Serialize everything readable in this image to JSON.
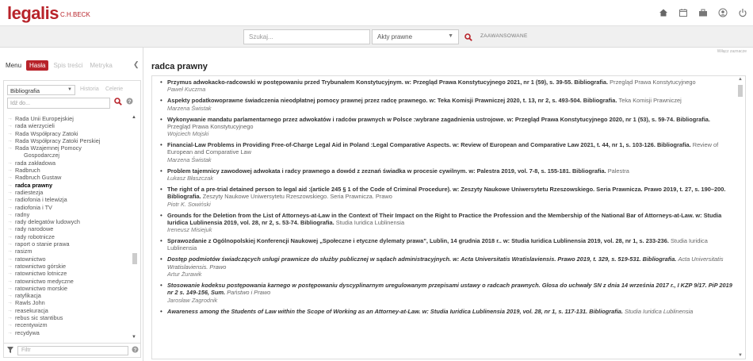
{
  "header": {
    "logo": "legalis",
    "logo_sub": "C.H.BECK",
    "icons": [
      "home-icon",
      "calendar-icon",
      "briefcase-icon",
      "user-icon",
      "power-icon"
    ]
  },
  "search": {
    "placeholder": "Szukaj...",
    "type_select": "Akty prawne",
    "advanced_label": "ZAAWANSOWANE"
  },
  "right_hint": "Wiłącz zaznacze",
  "left": {
    "tabs": [
      {
        "label": "Menu",
        "state": "plain"
      },
      {
        "label": "Hasła",
        "state": "active"
      },
      {
        "label": "Spis treści",
        "state": "disabled"
      },
      {
        "label": "Metryka",
        "state": "disabled"
      }
    ],
    "dropdown_value": "Bibliografia",
    "sub_tabs": [
      "Historia",
      "Celerie"
    ],
    "search_placeholder": "Idź do...",
    "tree": [
      {
        "label": "Rada Unii Europejskiej",
        "arrow": true
      },
      {
        "label": "rada wierzycieli",
        "arrow": true
      },
      {
        "label": "Rada Współpracy Zatoki",
        "arrow": true
      },
      {
        "label": "Rada Współpracy Zatoki Perskiej",
        "arrow": true
      },
      {
        "label": "Rada Wzajemnej Pomocy",
        "arrow": true
      },
      {
        "label": "Gospodarczej",
        "arrow": false
      },
      {
        "label": "rada zakładowa",
        "arrow": true
      },
      {
        "label": "Radbruch",
        "arrow": true
      },
      {
        "label": "Radbruch Gustaw",
        "arrow": true
      },
      {
        "label": "radca prawny",
        "arrow": true,
        "selected": true
      },
      {
        "label": "radiestezja",
        "arrow": true
      },
      {
        "label": "radiofonia i telewizja",
        "arrow": true
      },
      {
        "label": "radiofonia i TV",
        "arrow": true
      },
      {
        "label": "radny",
        "arrow": true
      },
      {
        "label": "rady delegatów ludowych",
        "arrow": true
      },
      {
        "label": "rady narodowe",
        "arrow": true
      },
      {
        "label": "rady robotnicze",
        "arrow": true
      },
      {
        "label": "raport o stanie prawa",
        "arrow": true
      },
      {
        "label": "rasizm",
        "arrow": true
      },
      {
        "label": "ratownictwo",
        "arrow": true
      },
      {
        "label": "ratownictwo górskie",
        "arrow": true
      },
      {
        "label": "ratownictwo lotnicze",
        "arrow": true
      },
      {
        "label": "ratownictwo medyczne",
        "arrow": true
      },
      {
        "label": "ratownictwo morskie",
        "arrow": true
      },
      {
        "label": "ratyfikacja",
        "arrow": true
      },
      {
        "label": "Rawls John",
        "arrow": true
      },
      {
        "label": "reasekuracja",
        "arrow": true
      },
      {
        "label": "rebus sic stantibus",
        "arrow": true
      },
      {
        "label": "recentywizm",
        "arrow": true
      },
      {
        "label": "recydywa",
        "arrow": true
      }
    ],
    "filter_placeholder": "Filtr"
  },
  "main": {
    "title": "radca prawny",
    "results": [
      {
        "title": "Przymus adwokacko-radcowski w postępowaniu przed Trybunałem Konstytucyjnym. w: Przegląd Prawa Konstytucyjnego 2021, nr 1 (59), s. 39-55. Bibliografia.",
        "type": "Przegląd Prawa Konstytucyjnego",
        "author": "Paweł Kuczma",
        "italic": false
      },
      {
        "title": "Aspekty podatkowoprawne świadczenia nieodpłatnej pomocy prawnej przez radcę prawnego. w: Teka Komisji Prawniczej 2020, t. 13, nr 2, s. 493-504. Bibliografia.",
        "type": "Teka Komisji Prawniczej",
        "author": "Marzena Świstak",
        "italic": false
      },
      {
        "title": "Wykonywanie mandatu parlamentarnego przez adwokatów i radców prawnych w Polsce :wybrane zagadnienia ustrojowe. w: Przegląd Prawa Konstytucyjnego 2020, nr 1 (53), s. 59-74. Bibliografia.",
        "type": "Przegląd Prawa Konstytucyjnego",
        "author": "Wojciech Mojski",
        "italic": false
      },
      {
        "title": "Financial-Law Problems in Providing Free-of-Charge Legal Aid in Poland :Legal Comparative Aspects. w: Review of European and Comparative Law 2021, t. 44, nr 1, s. 103-126. Bibliografia.",
        "type": "Review of European and Comparative Law",
        "author": "Marzena Świstak",
        "italic": false
      },
      {
        "title": "Problem tajemnicy zawodowej adwokata i radcy prawnego a dowód z zeznań świadka w procesie cywilnym. w: Palestra 2019, vol. 7-8, s. 155-181. Bibliografia.",
        "type": "Palestra",
        "author": "Łukasz Błaszczak",
        "italic": false
      },
      {
        "title": "The right of a pre-trial detained person to legal aid :(article 245 § 1 of the Code of Criminal Procedure). w: Zeszyty Naukowe Uniwersytetu Rzeszowskiego. Seria Prawnicza. Prawo 2019, t. 27, s. 190–200. Bibliografia.",
        "type": "Zeszyty Naukowe Uniwersytetu Rzeszowskiego. Seria Prawnicza. Prawo",
        "author": "Piotr K. Sowiński",
        "italic": false
      },
      {
        "title": "Grounds for the Deletion from the List of Attorneys-at-Law in the Context of Their Impact on the Right to Practice the Profession and the Membership of the National Bar of Attorneys-at-Law. w: Studia Iuridica Lublinensia 2019, vol. 28, nr 2, s. 53-74. Bibliografia.",
        "type": "Studia Iuridica Lublinensia",
        "author": "Ireneusz Misiejuk",
        "italic": false
      },
      {
        "title": "Sprawozdanie z Ogólnopolskiej Konferencji Naukowej „Społeczne i etyczne dylematy prawa”, Lublin, 14 grudnia 2018 r.. w: Studia Iuridica Lublinensia 2019, vol. 28, nr 1, s. 233-236.",
        "type": "Studia Iuridica Lublinensia",
        "author": "",
        "italic": false
      },
      {
        "title": "Dostęp podmiotów świadczących usługi prawnicze do służby publicznej w sądach administracyjnych. w: Acta Universitatis Wratislaviensis. Prawo 2019, t. 329, s. 519-531. Bibliografia.",
        "type": "Acta Universitatis Wratislaviensis. Prawo",
        "author": "Artur Żurawik",
        "italic": true
      },
      {
        "title": "Stosowanie kodeksu postępowania karnego w postępowaniu dyscyplinarnym uregulowanym przepisami ustawy o radcach prawnych. Glosa do uchwały SN z dnia 14 września 2017 r., I KZP 9/17. PiP 2019 nr 2 s. 149-156, Sum.",
        "type": "Państwo i Prawo",
        "author": "Jarosław Zagrodnik",
        "italic": true
      },
      {
        "title": "Awareness among the Students of Law within the Scope of Working as an Attorney-at-Law. w: Studia Iuridica Lublinensia 2019, vol. 28, nr 1, s. 117-131. Bibliografia.",
        "type": "Studia Iuridica Lublinensia",
        "author": "",
        "italic": true
      }
    ]
  },
  "colors": {
    "brand": "#b8232a"
  }
}
